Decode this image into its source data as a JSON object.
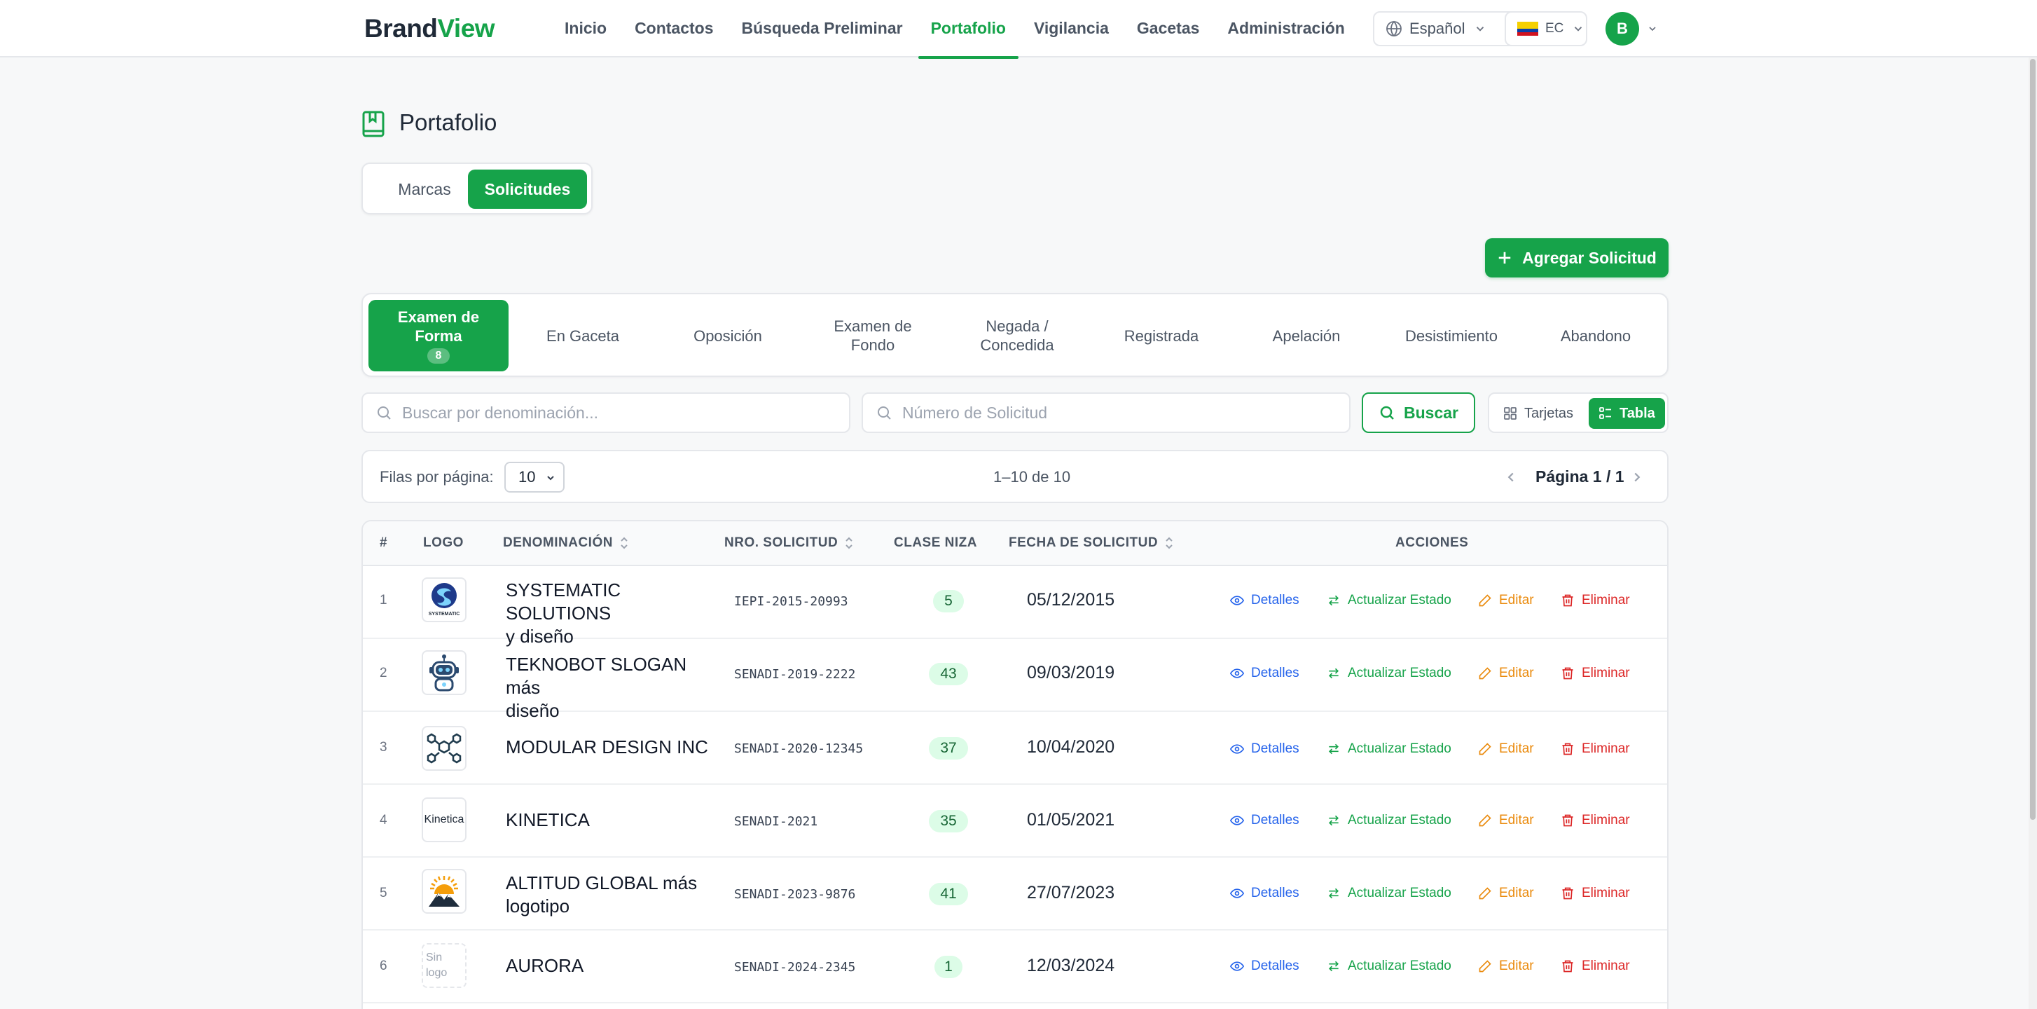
{
  "header": {
    "brand_part1": "Brand",
    "brand_part2": "View",
    "nav": [
      "Inicio",
      "Contactos",
      "Búsqueda Preliminar",
      "Portafolio",
      "Vigilancia",
      "Gacetas",
      "Administración"
    ],
    "active_nav": "Portafolio",
    "language": "Español",
    "country": "EC",
    "avatar_initial": "B"
  },
  "page": {
    "title": "Portafolio",
    "title_icon": "book-bookmark-icon"
  },
  "view_toggle": {
    "marcas": "Marcas",
    "solicitudes": "Solicitudes",
    "active": "Solicitudes"
  },
  "add_button": "Agregar Solicitud",
  "status_tabs": [
    {
      "line1": "Examen de",
      "line2": "Forma",
      "badge": "8",
      "active": true
    },
    {
      "line1": "En Gaceta",
      "line2": ""
    },
    {
      "line1": "Oposición",
      "line2": ""
    },
    {
      "line1": "Examen de",
      "line2": "Fondo"
    },
    {
      "line1": "Negada /",
      "line2": "Concedida"
    },
    {
      "line1": "Registrada",
      "line2": ""
    },
    {
      "line1": "Apelación",
      "line2": ""
    },
    {
      "line1": "Desistimiento",
      "line2": ""
    },
    {
      "line1": "Abandono",
      "line2": ""
    }
  ],
  "search": {
    "name_placeholder": "Buscar por denominación...",
    "number_placeholder": "Número de Solicitud",
    "button": "Buscar"
  },
  "layout_toggle": {
    "cards": "Tarjetas",
    "table": "Tabla",
    "active": "Tabla"
  },
  "pagination": {
    "rows_label": "Filas por página:",
    "rows_value": "10",
    "range": "1–10 de 10",
    "page_label": "Página 1 / 1"
  },
  "table": {
    "headers": {
      "num": "#",
      "logo": "LOGO",
      "denominacion": "DENOMINACIÓN",
      "nro_solicitud": "NRO. SOLICITUD",
      "clase_niza": "CLASE NIZA",
      "fecha": "FECHA DE SOLICITUD",
      "acciones": "ACCIONES"
    },
    "actions": {
      "details": "Detalles",
      "update": "Actualizar Estado",
      "edit": "Editar",
      "delete": "Eliminar"
    },
    "rows": [
      {
        "num": "1",
        "logo": "systematic",
        "logo_text": "SYSTEMATIC",
        "denominacion_1": "SYSTEMATIC SOLUTIONS",
        "denominacion_2": "y diseño",
        "nro": "IEPI-2015-20993",
        "niza": "5",
        "fecha": "05/12/2015"
      },
      {
        "num": "2",
        "logo": "robot",
        "denominacion_1": "TEKNOBOT SLOGAN más",
        "denominacion_2": "diseño",
        "nro": "SENADI-2019-2222",
        "niza": "43",
        "fecha": "09/03/2019"
      },
      {
        "num": "3",
        "logo": "modular",
        "denominacion_1": "MODULAR DESIGN INC",
        "denominacion_2": "",
        "nro": "SENADI-2020-12345",
        "niza": "37",
        "fecha": "10/04/2020"
      },
      {
        "num": "4",
        "logo": "text",
        "logo_text": "Kinetica",
        "denominacion_1": "KINETICA",
        "denominacion_2": "",
        "nro": "SENADI-2021",
        "niza": "35",
        "fecha": "01/05/2021"
      },
      {
        "num": "5",
        "logo": "mountain",
        "denominacion_1": "ALTITUD GLOBAL más",
        "denominacion_2": "logotipo",
        "nro": "SENADI-2023-9876",
        "niza": "41",
        "fecha": "27/07/2023"
      },
      {
        "num": "6",
        "logo": "none",
        "logo_text_1": "Sin",
        "logo_text_2": "logo",
        "denominacion_1": "AURORA",
        "denominacion_2": "",
        "nro": "SENADI-2024-2345",
        "niza": "1",
        "fecha": "12/03/2024"
      }
    ]
  },
  "colors": {
    "accent": "#16a34a",
    "details": "#2563eb",
    "edit": "#ea8a0c",
    "delete": "#dc2626",
    "badge_bg": "#dcfce7"
  }
}
